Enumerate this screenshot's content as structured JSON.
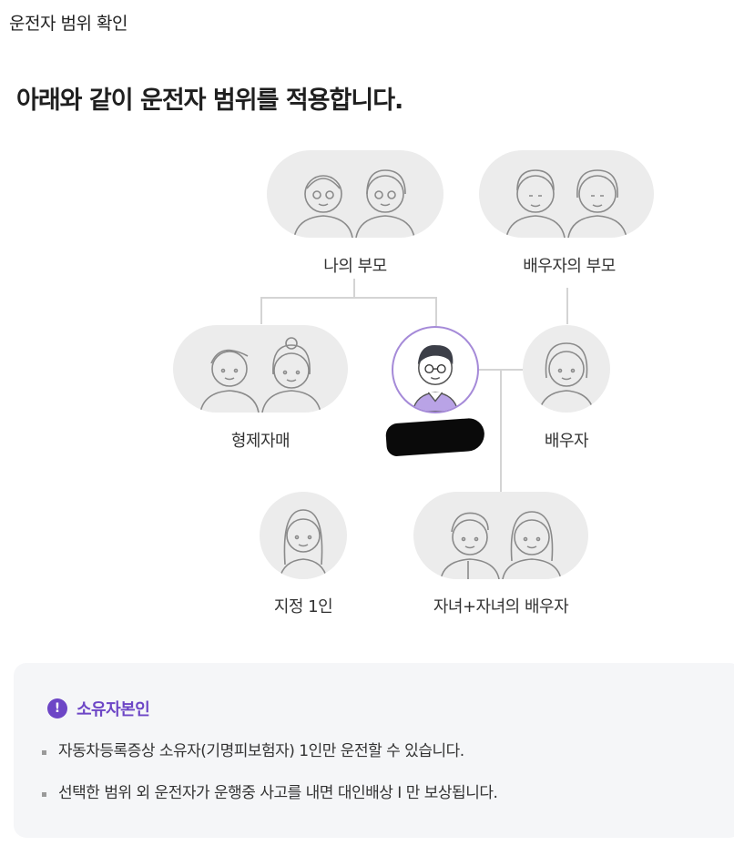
{
  "header": {
    "title": "운전자 범위 확인"
  },
  "headline": "아래와 같이 운전자 범위를 적용합니다.",
  "tree": {
    "my_parents": "나의 부모",
    "spouse_parents": "배우자의 부모",
    "siblings": "형제자매",
    "spouse": "배우자",
    "designated_one": "지정 1인",
    "children": "자녀+자녀의 배우자"
  },
  "info": {
    "icon_glyph": "!",
    "title": "소유자본인",
    "items": [
      "자동차등록증상 소유자(기명피보험자) 1인만 운전할 수 있습니다.",
      "선택한 범위 외 운전자가 운행중 사고를 내면 대인배상 I 만 보상됩니다."
    ]
  },
  "colors": {
    "accent": "#6d46c6",
    "self_border": "#a58ad8",
    "illustration_bg": "#ececec"
  },
  "icons": [
    "alert-icon",
    "person-illustration"
  ]
}
